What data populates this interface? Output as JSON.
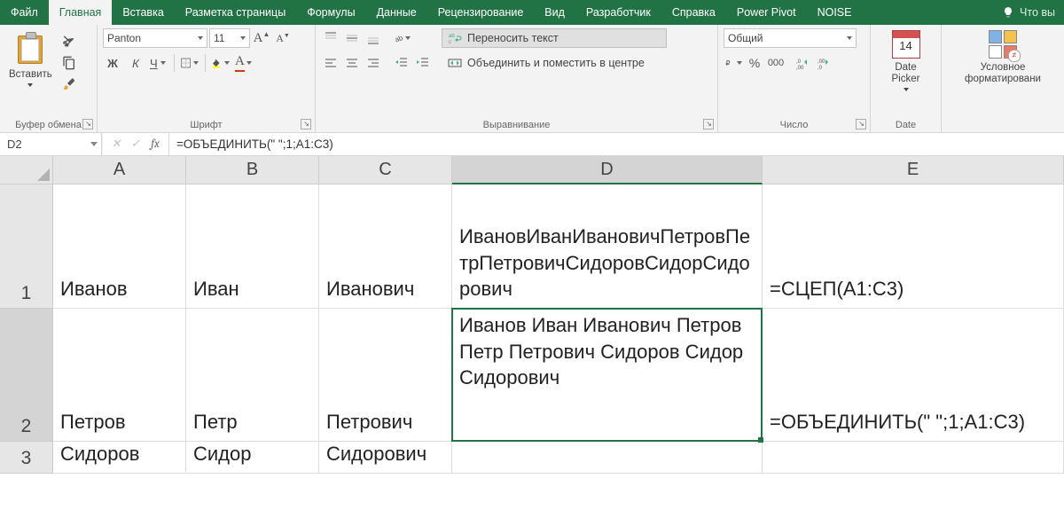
{
  "tabs": {
    "items": [
      "Файл",
      "Главная",
      "Вставка",
      "Разметка страницы",
      "Формулы",
      "Данные",
      "Рецензирование",
      "Вид",
      "Разработчик",
      "Справка",
      "Power Pivot",
      "NOISE"
    ],
    "active_index": 1,
    "tell_me": "Что вы"
  },
  "ribbon": {
    "clipboard": {
      "paste": "Вставить",
      "label": "Буфер обмена"
    },
    "font": {
      "name": "Panton",
      "size": "11",
      "label": "Шрифт",
      "bold": "Ж",
      "italic": "К",
      "underline": "Ч"
    },
    "alignment": {
      "wrap": "Переносить текст",
      "merge": "Объединить и поместить в центре",
      "label": "Выравнивание"
    },
    "number": {
      "format": "Общий",
      "label": "Число"
    },
    "date": {
      "btn": "Date Picker",
      "num": "14",
      "label": "Date"
    },
    "cond": {
      "btn": "Условное форматировани"
    }
  },
  "formula_bar": {
    "name_box": "D2",
    "formula": "=ОБЪЕДИНИТЬ(\" \";1;A1:C3)"
  },
  "columns": [
    "A",
    "B",
    "C",
    "D",
    "E"
  ],
  "rows": [
    "1",
    "2",
    "3"
  ],
  "cells": {
    "A1": "Иванов",
    "B1": "Иван",
    "C1": "Иванович",
    "D1": "ИвановИванИвановичПетровПетрПетровичСидоровСидорСидорович",
    "E1": "=СЦЕП(А1:С3)",
    "A2": "Петров",
    "B2": "Петр",
    "C2": "Петрович",
    "D2": "Иванов Иван Иванович Петров Петр Петрович Сидоров Сидор Сидорович",
    "E2": "=ОБЪЕДИНИТЬ(\" \";1;А1:С3)",
    "A3": "Сидоров",
    "B3": "Сидор",
    "C3": "Сидорович",
    "D3": "",
    "E3": ""
  },
  "selection": {
    "col": "D",
    "row": "2"
  }
}
